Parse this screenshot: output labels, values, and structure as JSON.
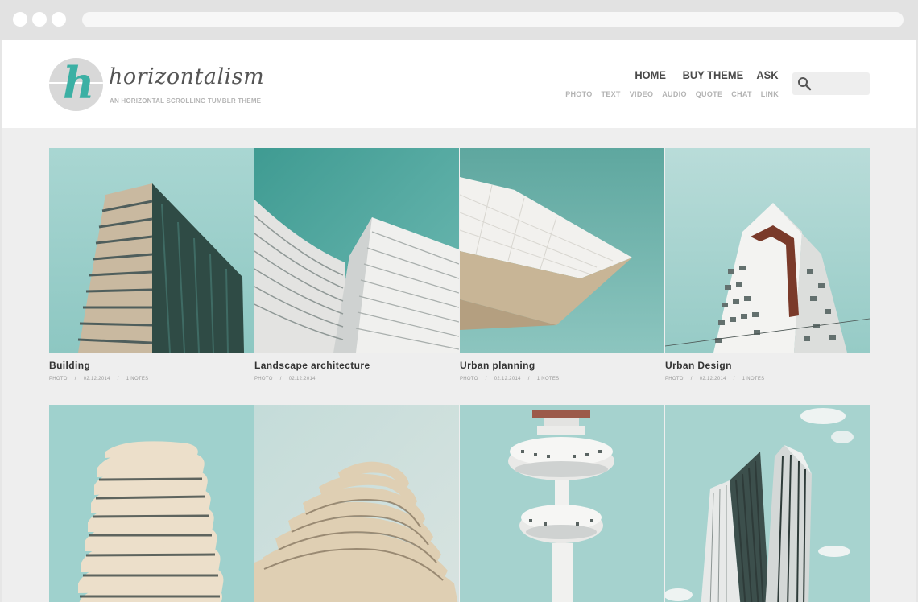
{
  "site": {
    "logo_letter": "h",
    "name": "horizontalism",
    "tagline": "AN HORIZONTAL SCROLLING TUMBLR THEME"
  },
  "nav": {
    "main": [
      {
        "label": "HOME"
      },
      {
        "label": "BUY THEME"
      },
      {
        "label": "ASK"
      }
    ],
    "types": [
      {
        "label": "PHOTO"
      },
      {
        "label": "TEXT"
      },
      {
        "label": "VIDEO"
      },
      {
        "label": "AUDIO"
      },
      {
        "label": "QUOTE"
      },
      {
        "label": "CHAT"
      },
      {
        "label": "LINK"
      }
    ]
  },
  "search": {
    "placeholder": ""
  },
  "colors": {
    "accent": "#3bb0a4",
    "sky": "#93c9c5",
    "text": "#333333",
    "meta": "#9a9a9a"
  },
  "posts": [
    {
      "title": "Building",
      "type": "PHOTO",
      "sep": "/",
      "date": "02.12.2014",
      "notes": "1 NOTES"
    },
    {
      "title": "Landscape architecture",
      "type": "PHOTO",
      "sep": "/",
      "date": "02.12.2014",
      "notes": ""
    },
    {
      "title": "Urban planning",
      "type": "PHOTO",
      "sep": "/",
      "date": "02.12.2014",
      "notes": "1 NOTES"
    },
    {
      "title": "Urban Design",
      "type": "PHOTO",
      "sep": "/",
      "date": "02.12.2014",
      "notes": "1 NOTES"
    },
    {
      "title": "",
      "type": "",
      "sep": "",
      "date": "",
      "notes": ""
    },
    {
      "title": "",
      "type": "",
      "sep": "",
      "date": "",
      "notes": ""
    },
    {
      "title": "",
      "type": "",
      "sep": "",
      "date": "",
      "notes": ""
    },
    {
      "title": "",
      "type": "",
      "sep": "",
      "date": "",
      "notes": ""
    }
  ]
}
